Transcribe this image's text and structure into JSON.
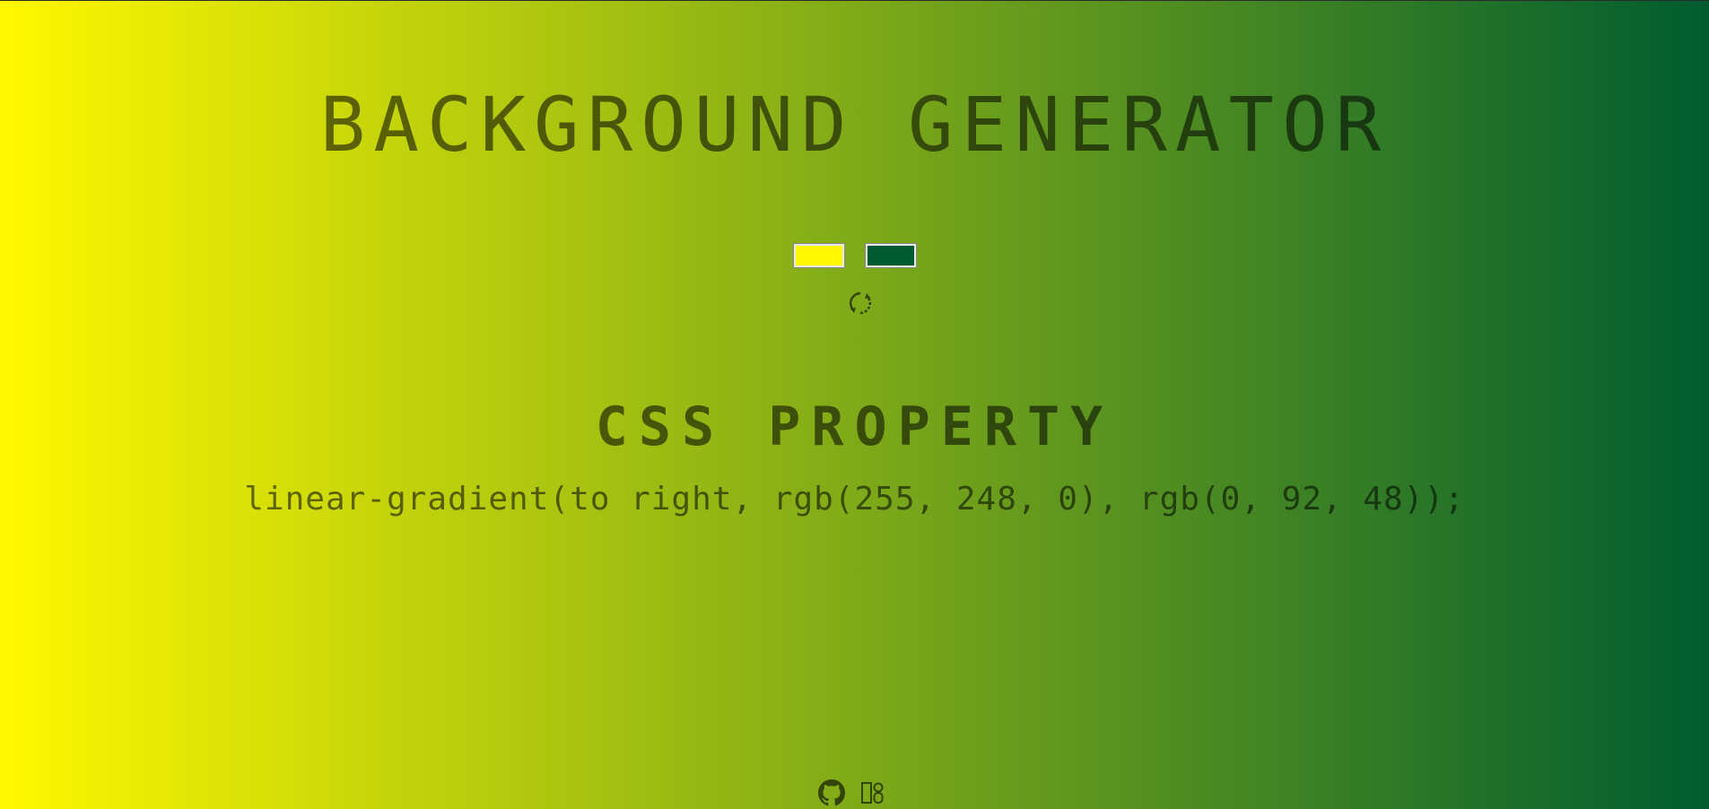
{
  "page": {
    "title": "BACKGROUND GENERATOR",
    "subtitle": "CSS PROPERTY",
    "css_output": "linear-gradient(to right, rgb(255, 248, 0), rgb(0, 92, 48));"
  },
  "colors": {
    "color1": "#fff800",
    "color2": "#005c30"
  },
  "controls": {
    "random_icon": "refresh-icon"
  },
  "footer": {
    "links": [
      {
        "icon": "github-icon"
      },
      {
        "icon": "portfolio-icon"
      }
    ]
  }
}
